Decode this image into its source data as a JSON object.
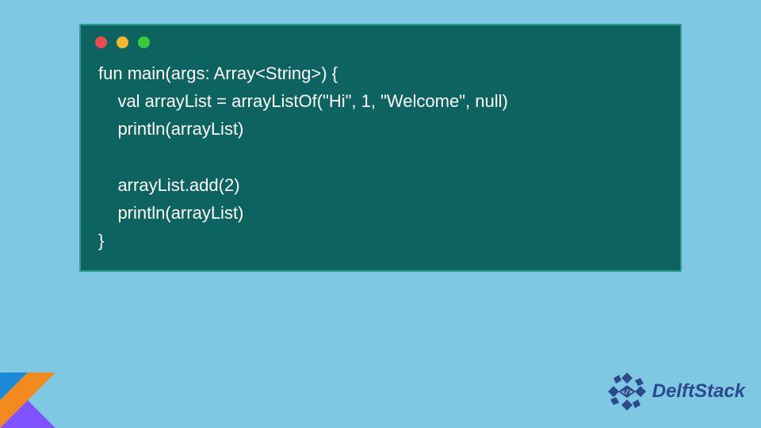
{
  "code": {
    "line1": "fun main(args: Array<String>) {",
    "line2": "    val arrayList = arrayListOf(\"Hi\", 1, \"Welcome\", null)",
    "line3": "    println(arrayList)",
    "line4": "",
    "line5": "    arrayList.add(2)",
    "line6": "    println(arrayList)",
    "line7": "}"
  },
  "brand": {
    "name": "DelftStack"
  },
  "colors": {
    "background": "#7ec8e3",
    "codeWindow": "#0d6360",
    "codeWindowBorder": "#2a9d8f",
    "dotRed": "#ed4c4c",
    "dotYellow": "#f5b82e",
    "dotGreen": "#3cc93c",
    "brandText": "#2b4a8b"
  }
}
